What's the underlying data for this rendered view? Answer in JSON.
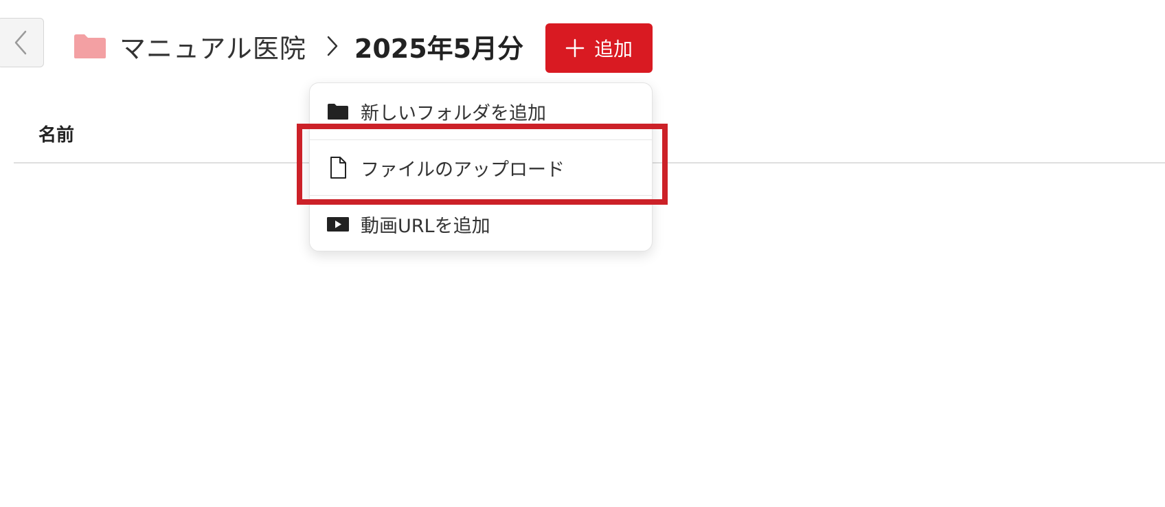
{
  "colors": {
    "accent": "#d91a22",
    "highlight": "#cc2128",
    "folder": "#f3a0a3"
  },
  "icons": {
    "back": "chevron-left-icon",
    "folder": "folder-icon",
    "separator": "chevron-right-icon",
    "add": "plus-icon"
  },
  "breadcrumb": {
    "root": "マニュアル医院",
    "current": "2025年5月分"
  },
  "toolbar": {
    "add_label": "追加"
  },
  "table": {
    "columns": [
      "名前"
    ]
  },
  "add_menu": {
    "items": [
      {
        "label": "新しいフォルダを追加",
        "icon": "folder-filled-icon"
      },
      {
        "label": "ファイルのアップロード",
        "icon": "file-icon",
        "highlighted": true
      },
      {
        "label": "動画URLを追加",
        "icon": "video-icon"
      }
    ]
  }
}
